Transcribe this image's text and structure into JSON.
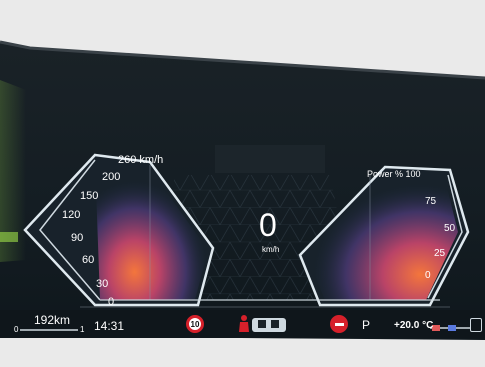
{
  "speedometer": {
    "unit_label": "260 km/h",
    "ticks": [
      "200",
      "150",
      "120",
      "90",
      "60",
      "30",
      "0"
    ]
  },
  "center": {
    "speed_value": "0",
    "speed_unit": "km/h"
  },
  "power_gauge": {
    "title": "Power % 100",
    "ticks": [
      "75",
      "50",
      "25",
      "0"
    ]
  },
  "status_bar": {
    "range_value": "192km",
    "range_scale_left": "0",
    "range_scale_right": "1",
    "clock": "14:31",
    "speed_limit": "10",
    "gear": "P",
    "outside_temp": "+20.0 °C"
  },
  "icons": [
    "speed-limit-sign-icon",
    "seatbelt-warning-icon",
    "car-status-icon",
    "no-entry-sign-icon",
    "driver-assist-icon"
  ],
  "colors": {
    "display_bg": "#131c22",
    "gauge_outline": "#e6eef4",
    "glow_orange": "#ff7a3d",
    "glow_purple": "#7a4fb5",
    "warning_red": "#d6202a",
    "left_edge_green": "#9fe04a"
  }
}
